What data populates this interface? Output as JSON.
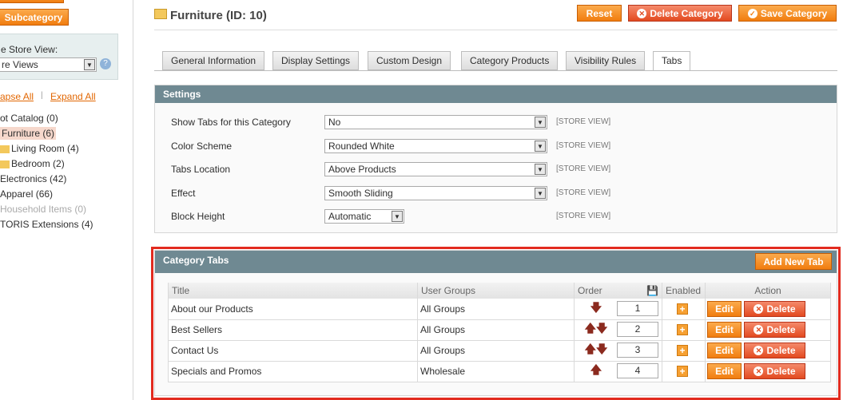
{
  "sidebar": {
    "add_subcategory": "Subcategory",
    "store_view_label": "e Store View:",
    "store_view_value": "re Views",
    "collapse_all": "apse All",
    "expand_all": "Expand All",
    "separator": "|",
    "tree": [
      {
        "label": "ot Catalog (0)",
        "indent": 0
      },
      {
        "label": "Furniture (6)",
        "indent": 0,
        "selected": true
      },
      {
        "label": "Living Room (4)",
        "indent": 1
      },
      {
        "label": "Bedroom (2)",
        "indent": 1
      },
      {
        "label": "Electronics (42)",
        "indent": 0
      },
      {
        "label": "Apparel (66)",
        "indent": 0
      },
      {
        "label": "Household Items (0)",
        "indent": 0,
        "disabled": true
      },
      {
        "label": "TORIS Extensions (4)",
        "indent": 0
      }
    ]
  },
  "header": {
    "title": "Furniture (ID: 10)",
    "reset": "Reset",
    "delete": "Delete Category",
    "save": "Save Category"
  },
  "tabs": [
    "General Information",
    "Display Settings",
    "Custom Design",
    "Category Products",
    "Visibility Rules",
    "Tabs"
  ],
  "settings": {
    "title": "Settings",
    "scope": "[STORE VIEW]",
    "fields": [
      {
        "label": "Show Tabs for this Category",
        "value": "No"
      },
      {
        "label": "Color Scheme",
        "value": "Rounded White"
      },
      {
        "label": "Tabs Location",
        "value": "Above Products"
      },
      {
        "label": "Effect",
        "value": "Smooth Sliding"
      },
      {
        "label": "Block Height",
        "value": "Automatic"
      }
    ]
  },
  "category_tabs": {
    "title": "Category Tabs",
    "add_button": "Add New Tab",
    "columns": [
      "Title",
      "User Groups",
      "Order",
      "Enabled",
      "Action"
    ],
    "edit": "Edit",
    "delete": "Delete",
    "rows": [
      {
        "title": "About our Products",
        "group": "All Groups",
        "order": "1",
        "up": false,
        "down": true
      },
      {
        "title": "Best Sellers",
        "group": "All Groups",
        "order": "2",
        "up": true,
        "down": true
      },
      {
        "title": "Contact Us",
        "group": "All Groups",
        "order": "3",
        "up": true,
        "down": true
      },
      {
        "title": "Specials and Promos",
        "group": "Wholesale",
        "order": "4",
        "up": true,
        "down": false
      }
    ]
  },
  "colors": {
    "accent": "#f17d0f",
    "bar": "#6f8992",
    "highlight": "#e22b1f"
  }
}
